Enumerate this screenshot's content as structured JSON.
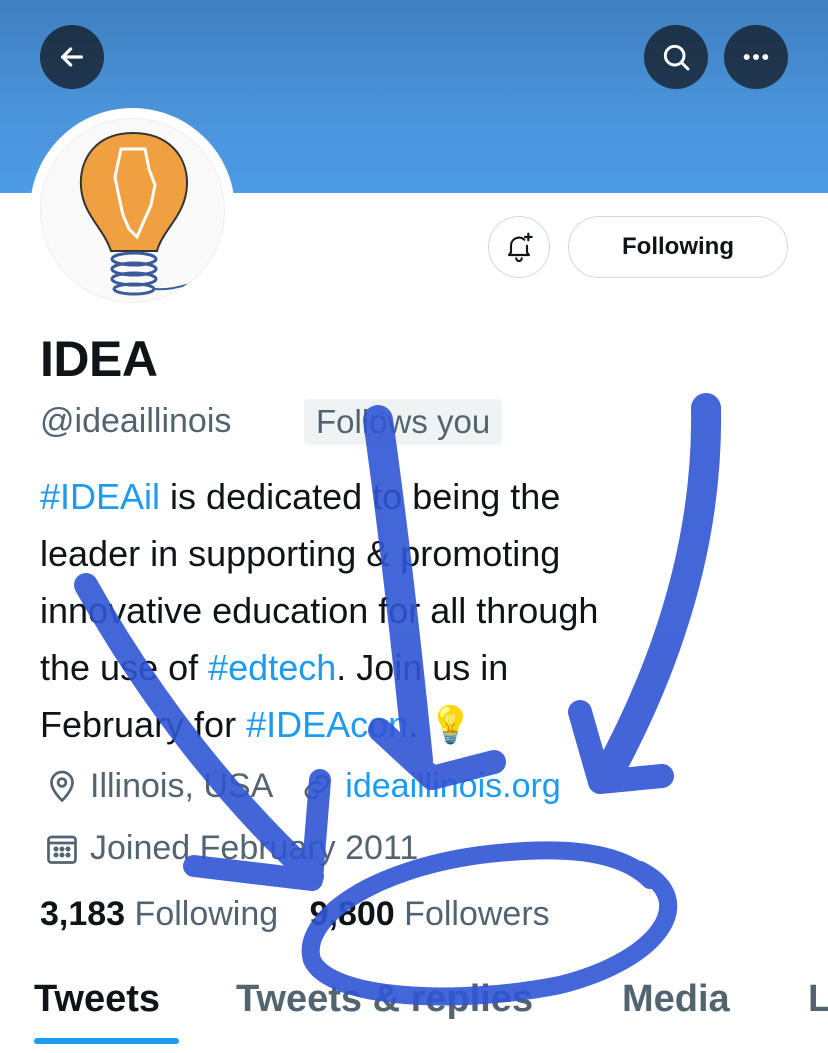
{
  "header": {
    "back_icon": "arrow-left-icon",
    "search_icon": "search-icon",
    "more_icon": "more-horizontal-icon",
    "banner_color": "#4a93da"
  },
  "profile": {
    "name": "IDEA",
    "handle": "@ideaillinois",
    "follows_you": "Follows you",
    "following_button": "Following",
    "bell_icon": "notification-bell-plus-icon",
    "bio": {
      "hashtag1": "#IDEAil",
      "line1_rest": " is dedicated to being the",
      "line2": "leader in supporting & promoting",
      "line3": "innovative education for all through",
      "line4_start": "the use of ",
      "hashtag2": "#edtech",
      "line4_end": ". Join us in",
      "line5_start": "February for ",
      "hashtag3": "#IDEAcon",
      "line5_end": ". 💡"
    },
    "location": "Illinois, USA",
    "website": "ideaillinois.org",
    "joined": "Joined February 2011"
  },
  "stats": {
    "following_count": "3,183",
    "following_label": "Following",
    "followers_count": "9,800",
    "followers_label": "Followers"
  },
  "tabs": [
    "Tweets",
    "Tweets & replies",
    "Media",
    "L"
  ],
  "colors": {
    "accent": "#1d9bf0",
    "annotation": "#2f55d4"
  }
}
